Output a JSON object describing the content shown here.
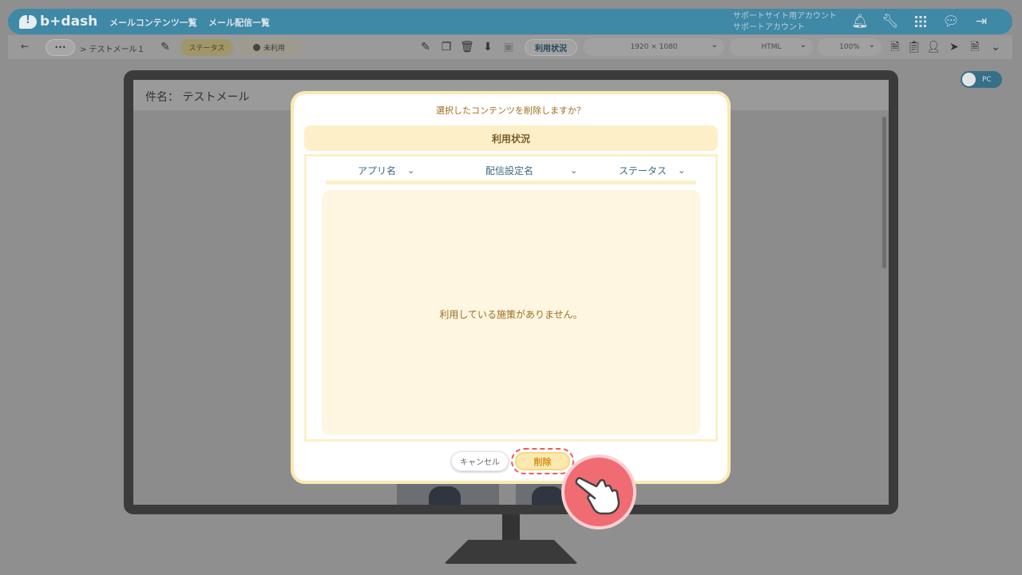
{
  "header": {
    "brand": "b+dash",
    "nav": [
      "メールコンテンツ一覧",
      "メール配信一覧"
    ],
    "account_line1": "サポートサイト用アカウント",
    "account_line2": "サポートアカウント",
    "icons": [
      "bell-icon",
      "wrench-icon",
      "grid-icon",
      "support-chat-icon",
      "logout-icon"
    ]
  },
  "toolbar": {
    "back_icon": "←",
    "more_label": "•••",
    "breadcrumb": "> テストメール１",
    "status_label": "ステータス",
    "status_value": "未利用",
    "usage_button": "利用状況",
    "resolution": "1920 × 1080",
    "format": "HTML",
    "zoom": "100%",
    "edit_icons": [
      "edit-icon",
      "copy-icon",
      "trash-icon",
      "download-icon",
      "disabled-icon"
    ],
    "right_icons": [
      "html-file-icon",
      "clipboard-icon",
      "contact-icon",
      "send-icon",
      "document-icon",
      "chevron-down-icon"
    ]
  },
  "preview": {
    "toggle_label": "PC",
    "subject_label": "件名：",
    "subject_value": "テストメール"
  },
  "dialog": {
    "title": "選択したコンテンツを削除しますか？",
    "section_title": "利用状況",
    "columns": [
      "アプリ名",
      "配信設定名",
      "ステータス"
    ],
    "empty_message": "利用している施策がありません。",
    "cancel_label": "キャンセル",
    "delete_label": "削除"
  },
  "colors": {
    "header": "#3f88a6",
    "dialog_border": "#fbe9b1",
    "accent_red": "#ef5b6a",
    "delete_text": "#d98f1d"
  }
}
